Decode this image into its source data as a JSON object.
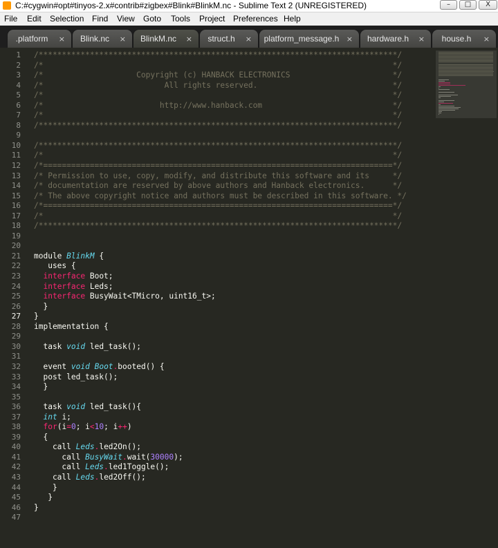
{
  "window": {
    "title": "C:#cygwin#opt#tinyos-2.x#contrib#zigbex#Blink#BlinkM.nc - Sublime Text 2 (UNREGISTERED)",
    "minimize_glyph": "–",
    "maximize_glyph": "□",
    "close_glyph": "X"
  },
  "menu": [
    "File",
    "Edit",
    "Selection",
    "Find",
    "View",
    "Goto",
    "Tools",
    "Project",
    "Preferences",
    "Help"
  ],
  "tabs": [
    {
      "label": ".platform",
      "close": "×"
    },
    {
      "label": "Blink.nc",
      "close": "×"
    },
    {
      "label": "BlinkM.nc",
      "close": "×",
      "active": true
    },
    {
      "label": "struct.h",
      "close": "×"
    },
    {
      "label": "platform_message.h",
      "close": "×"
    },
    {
      "label": "hardware.h",
      "close": "×"
    },
    {
      "label": "house.h",
      "close": "×"
    }
  ],
  "editor": {
    "current_line": 27,
    "lines": [
      [
        [
          "cm",
          "/*****************************************************************************/"
        ]
      ],
      [
        [
          "cm",
          "/*                                                                           */"
        ]
      ],
      [
        [
          "cm",
          "/*                    Copyright (c) HANBACK ELECTRONICS                      */"
        ]
      ],
      [
        [
          "cm",
          "/*                          All rights reserved.                             */"
        ]
      ],
      [
        [
          "cm",
          "/*                                                                           */"
        ]
      ],
      [
        [
          "cm",
          "/*                         http://www.hanback.com                            */"
        ]
      ],
      [
        [
          "cm",
          "/*                                                                           */"
        ]
      ],
      [
        [
          "cm",
          "/*****************************************************************************/"
        ]
      ],
      [],
      [
        [
          "cm",
          "/*****************************************************************************/"
        ]
      ],
      [
        [
          "cm",
          "/*                                                                           */"
        ]
      ],
      [
        [
          "cm",
          "/*===========================================================================*/"
        ]
      ],
      [
        [
          "cm",
          "/* Permission to use, copy, modify, and distribute this software and its     */"
        ]
      ],
      [
        [
          "cm",
          "/* documentation are reserved by above authors and Hanback electronics.      */"
        ]
      ],
      [
        [
          "cm",
          "/* The above copyright notice and authors must be described in this software. */"
        ]
      ],
      [
        [
          "cm",
          "/*===========================================================================*/"
        ]
      ],
      [
        [
          "cm",
          "/*                                                                           */"
        ]
      ],
      [
        [
          "cm",
          "/*****************************************************************************/"
        ]
      ],
      [],
      [],
      [
        [
          "",
          "module "
        ],
        [
          "st",
          "BlinkM"
        ],
        [
          "",
          " {"
        ]
      ],
      [
        [
          "",
          "   uses {"
        ]
      ],
      [
        [
          "",
          "  "
        ],
        [
          "kw",
          "interface"
        ],
        [
          "",
          " Boot;"
        ]
      ],
      [
        [
          "",
          "  "
        ],
        [
          "kw",
          "interface"
        ],
        [
          "",
          " Leds;"
        ]
      ],
      [
        [
          "",
          "  "
        ],
        [
          "kw",
          "interface"
        ],
        [
          "",
          " BusyWait<TMicro, uint16_t>;"
        ]
      ],
      [
        [
          "",
          "  }"
        ]
      ],
      [
        [
          "",
          "}"
        ]
      ],
      [
        [
          "",
          "implementation {"
        ]
      ],
      [],
      [
        [
          "",
          "  task "
        ],
        [
          "st",
          "void"
        ],
        [
          "",
          " led_task();"
        ]
      ],
      [],
      [
        [
          "",
          "  event "
        ],
        [
          "st",
          "void"
        ],
        [
          "",
          " "
        ],
        [
          "st",
          "Boot"
        ],
        [
          "op",
          "."
        ],
        [
          "",
          "booted() {"
        ]
      ],
      [
        [
          "",
          "  post led_task();"
        ]
      ],
      [
        [
          "",
          "  }"
        ]
      ],
      [],
      [
        [
          "",
          "  task "
        ],
        [
          "st",
          "void"
        ],
        [
          "",
          " led_task(){"
        ]
      ],
      [
        [
          "",
          "  "
        ],
        [
          "st",
          "int"
        ],
        [
          "",
          " i;"
        ]
      ],
      [
        [
          "",
          "  "
        ],
        [
          "kw",
          "for"
        ],
        [
          "",
          "(i"
        ],
        [
          "op",
          "="
        ],
        [
          "nm",
          "0"
        ],
        [
          "",
          "; i"
        ],
        [
          "op",
          "<"
        ],
        [
          "nm",
          "10"
        ],
        [
          "",
          "; i"
        ],
        [
          "op",
          "++"
        ],
        [
          "",
          ")"
        ]
      ],
      [
        [
          "",
          "  {"
        ]
      ],
      [
        [
          "",
          "    call "
        ],
        [
          "st",
          "Leds"
        ],
        [
          "op",
          "."
        ],
        [
          "",
          "led2On();"
        ]
      ],
      [
        [
          "",
          "      call "
        ],
        [
          "st",
          "BusyWait"
        ],
        [
          "op",
          "."
        ],
        [
          "",
          "wait("
        ],
        [
          "nm",
          "30000"
        ],
        [
          "",
          ");"
        ]
      ],
      [
        [
          "",
          "      call "
        ],
        [
          "st",
          "Leds"
        ],
        [
          "op",
          "."
        ],
        [
          "",
          "led1Toggle();"
        ]
      ],
      [
        [
          "",
          "    call "
        ],
        [
          "st",
          "Leds"
        ],
        [
          "op",
          "."
        ],
        [
          "",
          "led2Off();"
        ]
      ],
      [
        [
          "",
          "    }"
        ]
      ],
      [
        [
          "",
          "   }"
        ]
      ],
      [
        [
          "",
          "}"
        ]
      ],
      []
    ]
  }
}
